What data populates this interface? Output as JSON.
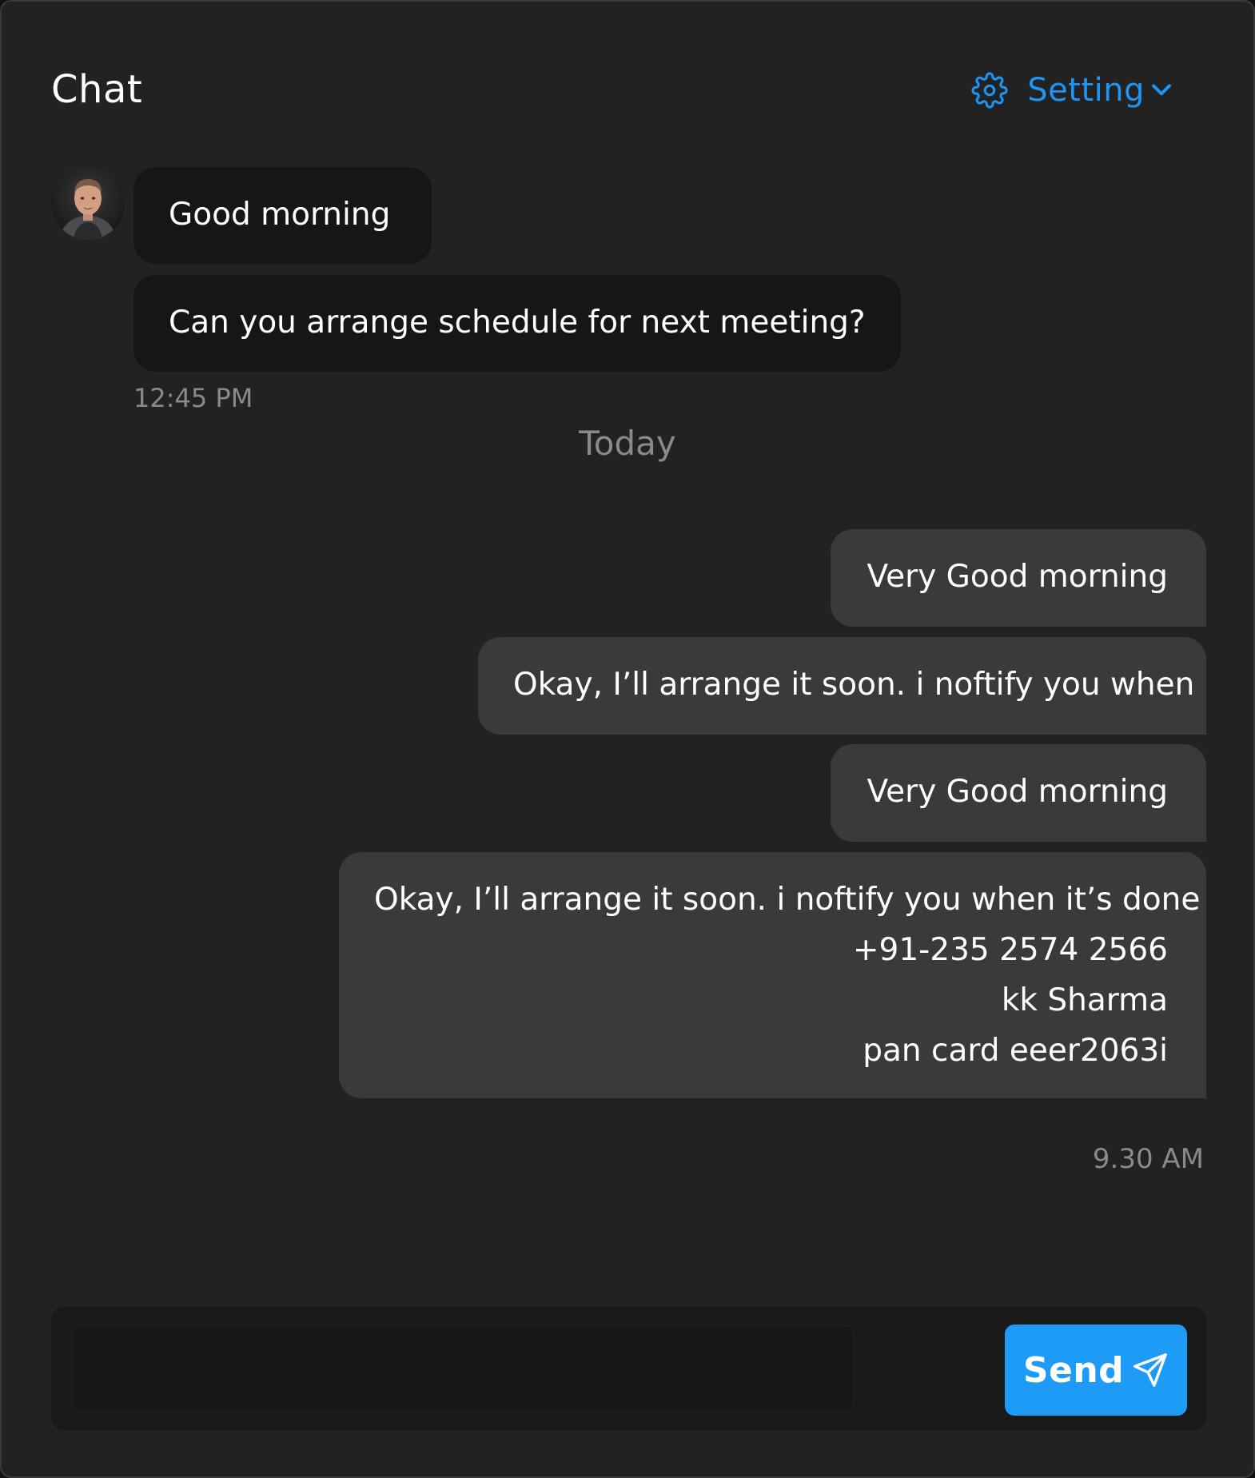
{
  "header": {
    "title": "Chat",
    "settings_label": "Setting",
    "settings_icon": "gear-icon",
    "dropdown_icon": "chevron-down-icon",
    "accent_color": "#1e95f3"
  },
  "incoming": {
    "avatar": "avatar",
    "messages": [
      "Good morning",
      "Can you arrange schedule for next meeting?"
    ],
    "time": "12:45 PM"
  },
  "divider": "Today",
  "outgoing": {
    "messages": [
      "Very Good morning",
      "Okay, I’ll arrange it soon. i noftify you when",
      "Very Good morning"
    ],
    "multiline": {
      "line1": "Okay, I’ll arrange it soon. i noftify you when it’s done",
      "line2": "+91-235 2574 2566",
      "line3": "kk Sharma",
      "line4": "pan card eeer2063i"
    },
    "time": "9.30 AM"
  },
  "composer": {
    "input_value": "",
    "send_label": "Send",
    "send_icon": "paper-plane-icon",
    "send_color": "#1e9bf6"
  }
}
